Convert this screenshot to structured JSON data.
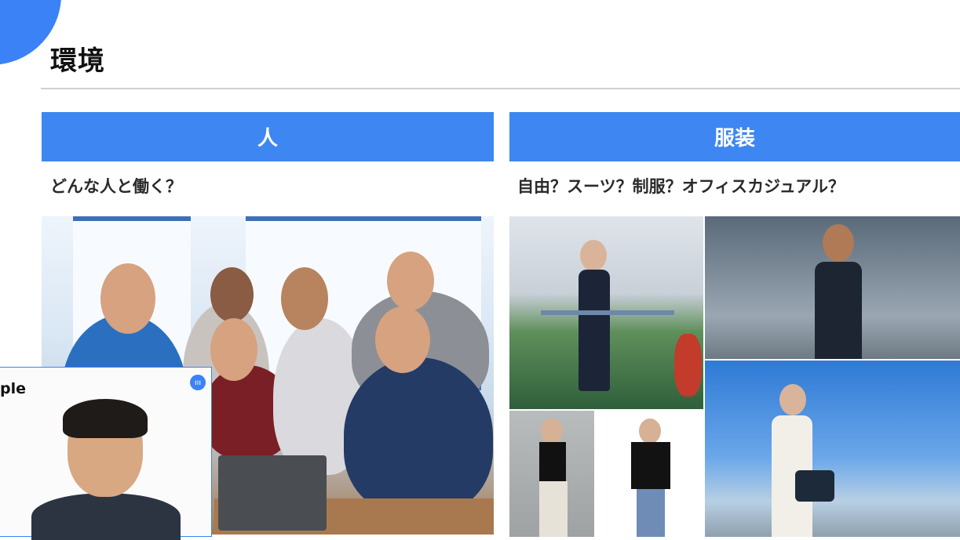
{
  "page": {
    "title": "環境"
  },
  "columns": [
    {
      "header": "人",
      "subtitle": "どんな人と働く？"
    },
    {
      "header": "服装",
      "subtitle": "自由？スーツ？制服？オフィスカジュアル？"
    }
  ],
  "video_call": {
    "participant_label": "ple",
    "speaking_indicator": "ııı"
  },
  "colors": {
    "accent": "#3e86f1",
    "title_text": "#111111",
    "subtitle_text": "#2b2b2b",
    "rule": "#d0d0d0"
  }
}
